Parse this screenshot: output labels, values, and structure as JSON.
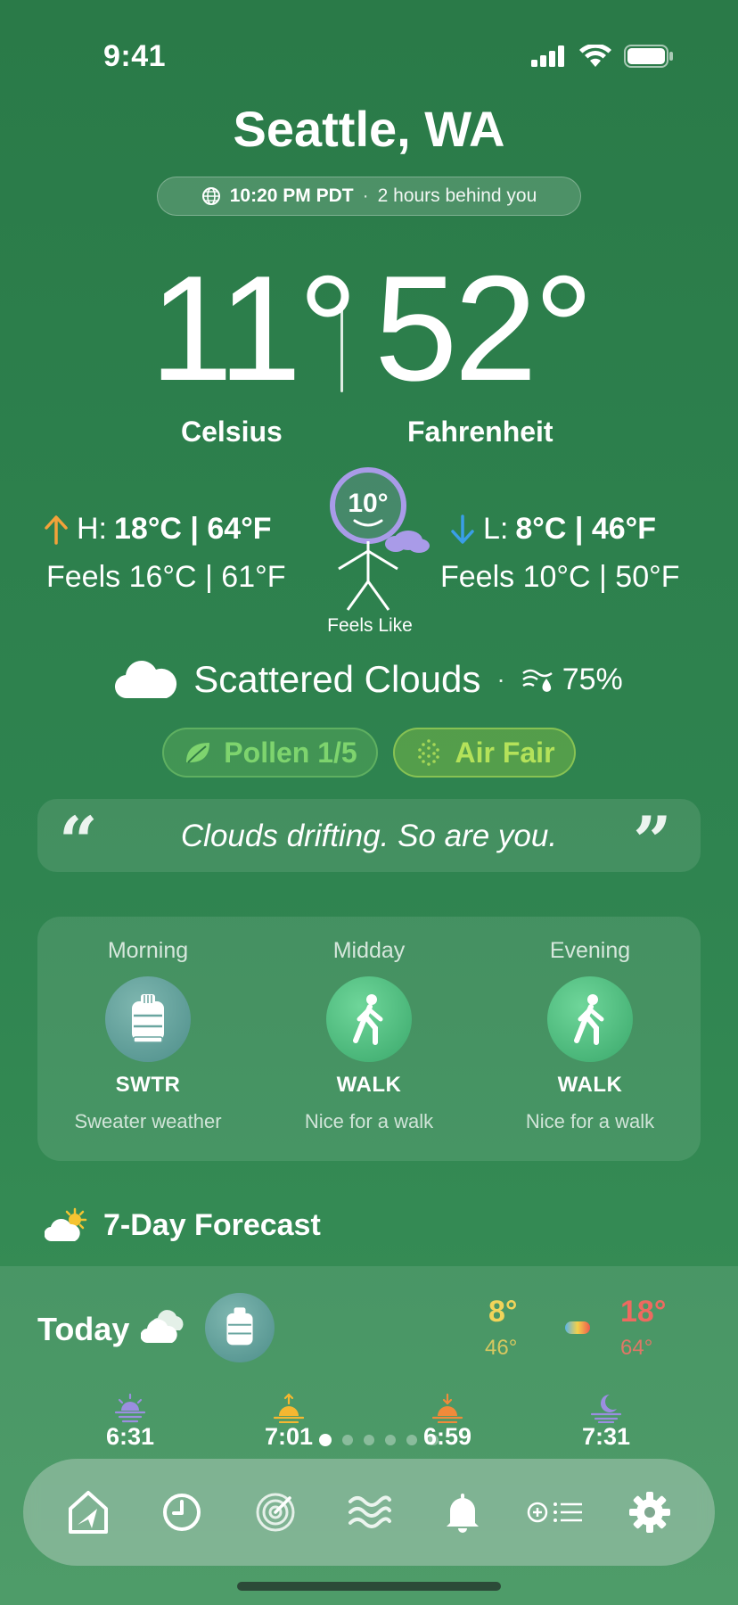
{
  "status_bar": {
    "time": "9:41"
  },
  "header": {
    "city": "Seattle, WA",
    "local_time": "10:20 PM PDT",
    "separator": "·",
    "relative": "2 hours behind you"
  },
  "current": {
    "temp_c": "11°",
    "temp_f": "52°",
    "label_c": "Celsius",
    "label_f": "Fahrenheit",
    "high_prefix": "H:",
    "high_value": "18°C | 64°F",
    "high_feels": "Feels 16°C | 61°F",
    "low_prefix": "L:",
    "low_value": "8°C | 46°F",
    "low_feels": "Feels 10°C | 50°F",
    "feels_badge": "10°",
    "feels_label": "Feels Like",
    "condition": "Scattered Clouds",
    "condition_sep": "·",
    "humidity": "75%"
  },
  "chips": {
    "pollen": "Pollen 1/5",
    "air": "Air Fair"
  },
  "quote": {
    "text": "Clouds drifting. So are you."
  },
  "day_parts": [
    {
      "title": "Morning",
      "code": "SWTR",
      "desc": "Sweater weather",
      "icon": "sweater-icon"
    },
    {
      "title": "Midday",
      "code": "WALK",
      "desc": "Nice for a walk",
      "icon": "walk-icon"
    },
    {
      "title": "Evening",
      "code": "WALK",
      "desc": "Nice for a walk",
      "icon": "walk-icon"
    }
  ],
  "forecast": {
    "title": "7-Day Forecast",
    "today": {
      "label": "Today",
      "low_c": "8°",
      "low_f": "46°",
      "high_c": "18°",
      "high_f": "64°"
    },
    "sun_times": [
      "6:31",
      "7:01",
      "6:59",
      "7:31"
    ],
    "pager": {
      "pages": 6,
      "active": 1
    }
  },
  "colors": {
    "background": "#2f8450",
    "low_temp": "#f2d45a",
    "high_temp": "#ee6a60",
    "pollen": "#7ed46e",
    "air": "#b4e25a",
    "arrow_up": "#f3a23a",
    "arrow_down": "#3a9ee8"
  },
  "nav": [
    "location-icon",
    "clock-icon",
    "radar-icon",
    "waves-icon",
    "bell-icon",
    "list-icon",
    "gear-icon"
  ]
}
